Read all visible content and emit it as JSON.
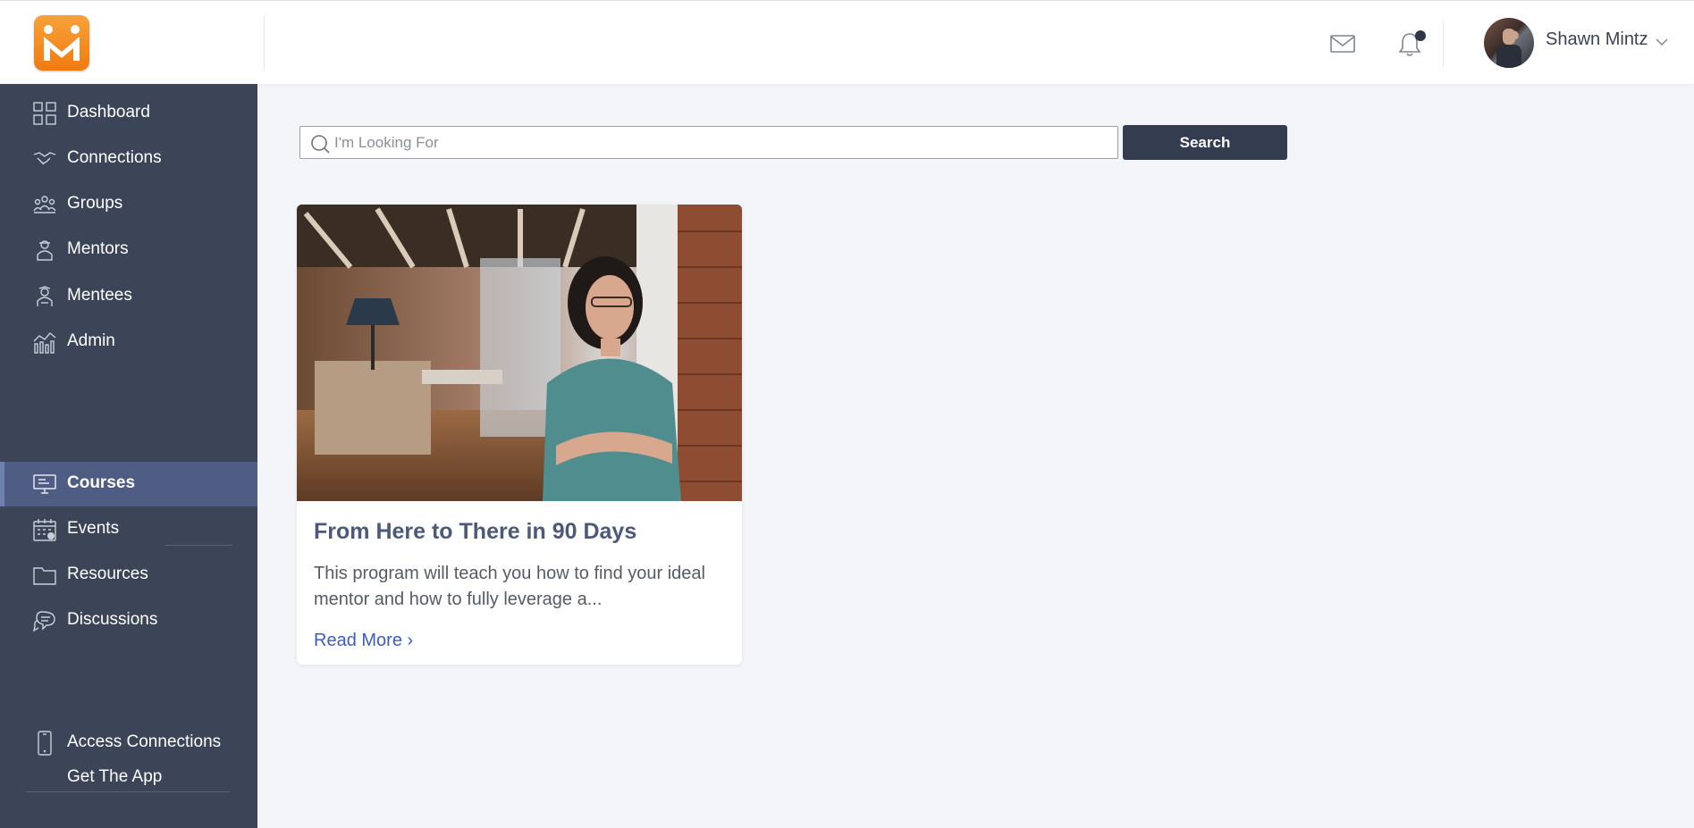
{
  "app": {
    "logo_icon": "m-logo-icon",
    "brand_color": "#f07a10"
  },
  "header": {
    "mail_icon": "envelope-icon",
    "notification_icon": "bell-icon",
    "notification_badge": true,
    "user_name": "Shawn Mintz",
    "user_menu_icon": "chevron-down-icon"
  },
  "sidebar": {
    "background": "#3b4557",
    "active_color": "#4f5d85",
    "items": [
      {
        "label": "Dashboard",
        "icon": "dashboard-grid-icon"
      },
      {
        "label": "Connections",
        "icon": "handshake-icon"
      },
      {
        "label": "Groups",
        "icon": "group-icon"
      },
      {
        "label": "Mentors",
        "icon": "mentor-icon"
      },
      {
        "label": "Mentees",
        "icon": "mentee-icon"
      },
      {
        "label": "Admin",
        "icon": "chart-icon"
      },
      {
        "label": "Courses",
        "icon": "monitor-icon",
        "active": true
      },
      {
        "label": "Events",
        "icon": "calendar-icon"
      },
      {
        "label": "Resources",
        "icon": "folder-icon"
      },
      {
        "label": "Discussions",
        "icon": "chat-bubbles-icon"
      }
    ],
    "app_promo": {
      "line1": "Access Connections",
      "line2": "Get The App",
      "icon": "phone-icon"
    }
  },
  "search": {
    "placeholder": "I'm Looking For",
    "value": "",
    "button_label": "Search",
    "icon": "search-icon"
  },
  "courses": [
    {
      "title": "From Here to There in 90 Days",
      "description": "This program will teach you how to find your ideal mentor and how to fully leverage a...",
      "link_label": "Read More ›",
      "image_alt": "woman-in-office-photo"
    }
  ]
}
